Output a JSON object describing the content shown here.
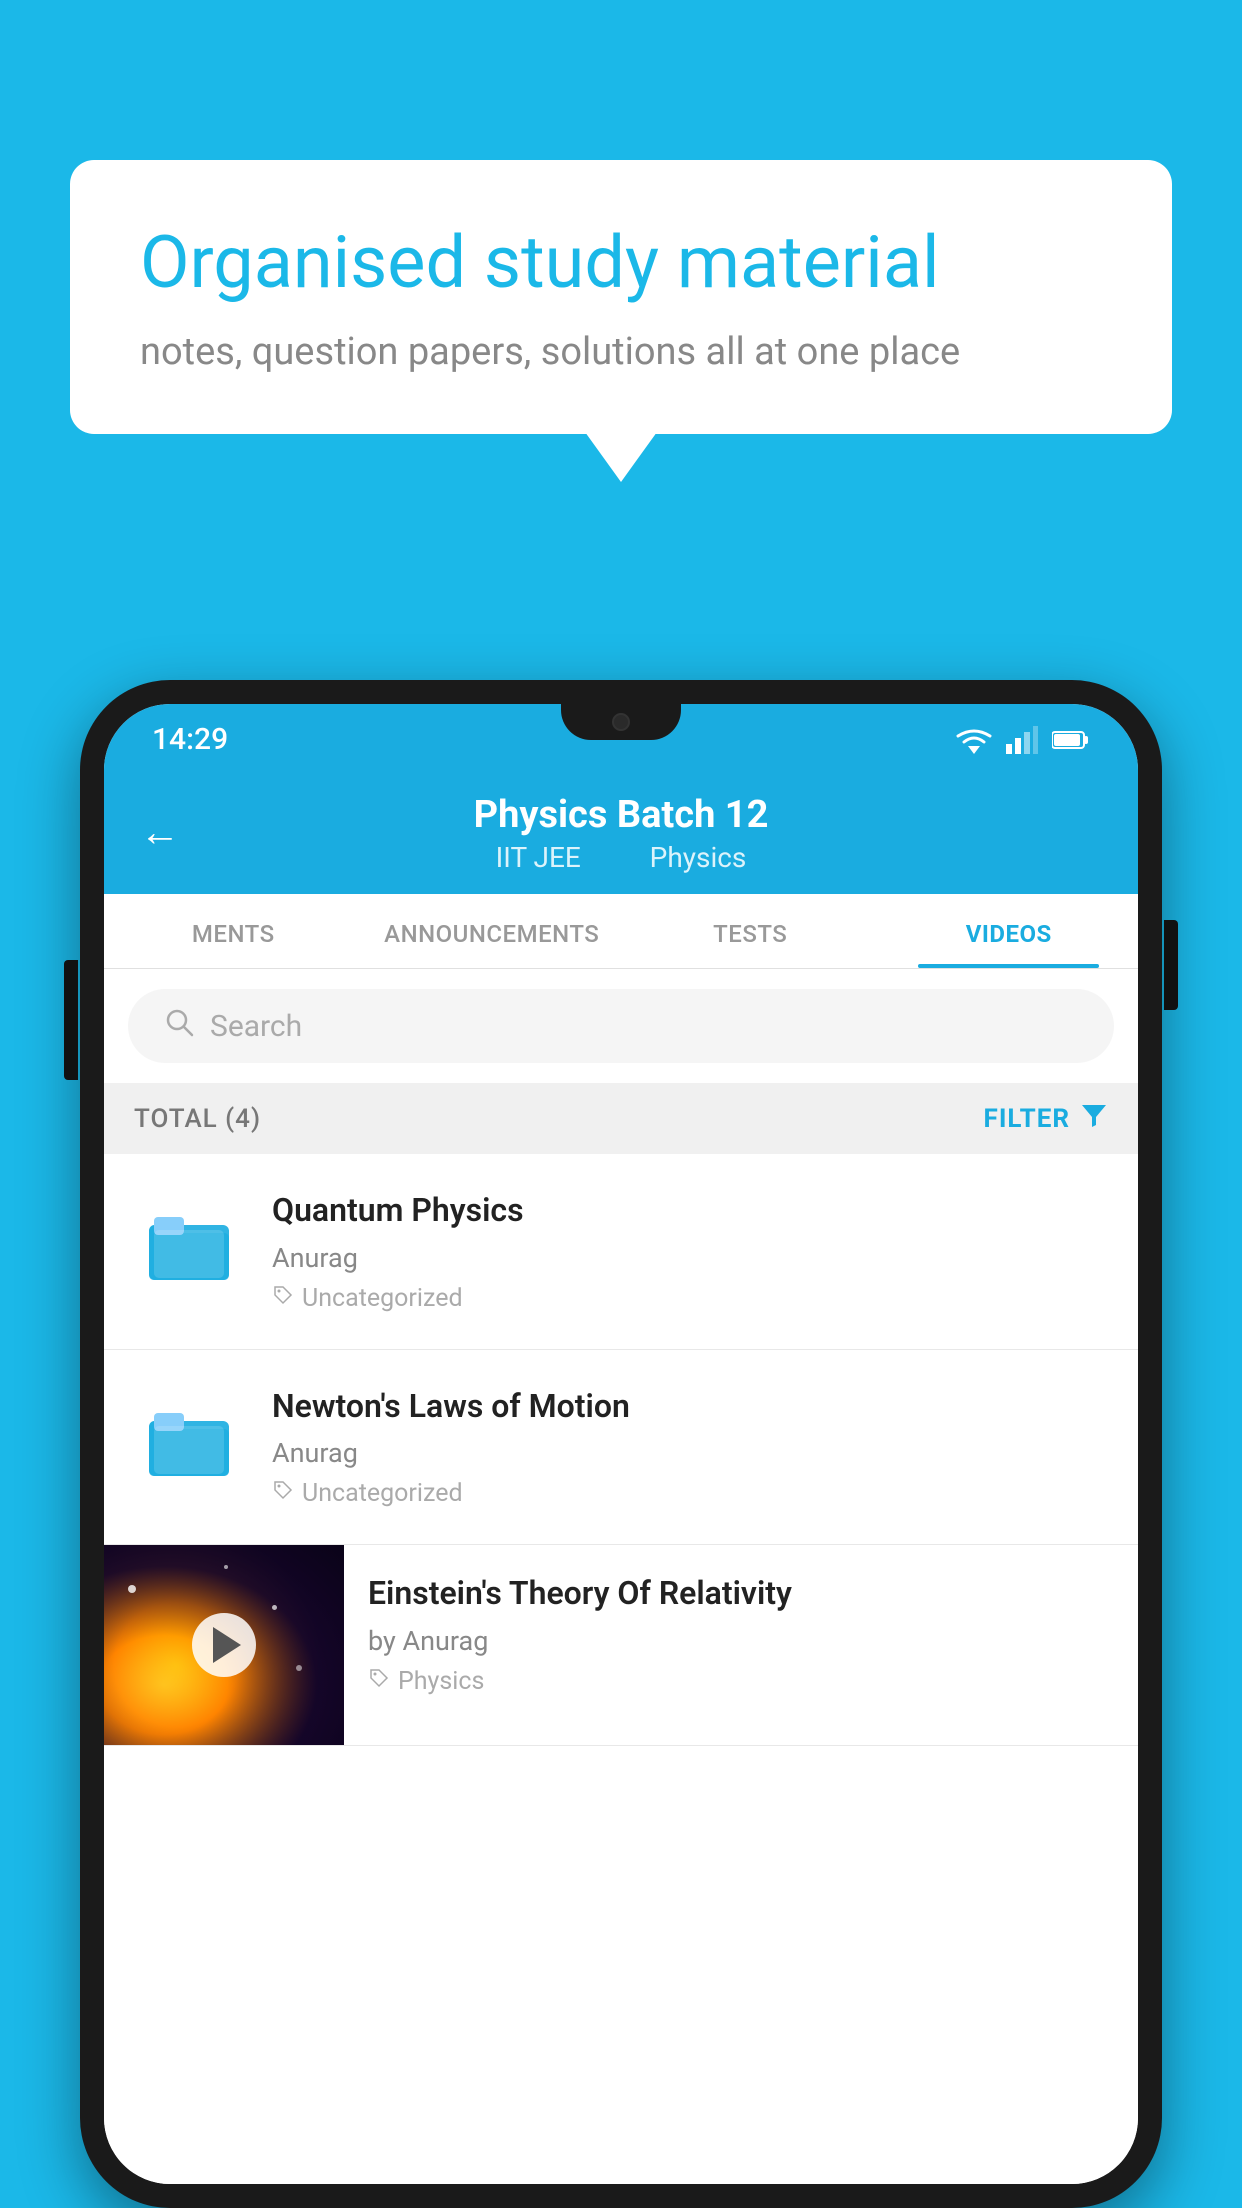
{
  "background_color": "#1BB8E8",
  "bubble": {
    "title": "Organised study material",
    "subtitle": "notes, question papers, solutions all at one place"
  },
  "status_bar": {
    "time": "14:29",
    "wifi_icon": "wifi",
    "signal_icon": "signal",
    "battery_icon": "battery"
  },
  "header": {
    "back_label": "←",
    "title": "Physics Batch 12",
    "subtitle_left": "IIT JEE",
    "subtitle_right": "Physics"
  },
  "tabs": [
    {
      "label": "MENTS",
      "active": false
    },
    {
      "label": "ANNOUNCEMENTS",
      "active": false
    },
    {
      "label": "TESTS",
      "active": false
    },
    {
      "label": "VIDEOS",
      "active": true
    }
  ],
  "search": {
    "placeholder": "Search"
  },
  "filter_bar": {
    "total_label": "TOTAL (4)",
    "filter_label": "FILTER"
  },
  "videos": [
    {
      "type": "folder",
      "title": "Quantum Physics",
      "author": "Anurag",
      "tag": "Uncategorized"
    },
    {
      "type": "folder",
      "title": "Newton's Laws of Motion",
      "author": "Anurag",
      "tag": "Uncategorized"
    },
    {
      "type": "thumbnail",
      "title": "Einstein's Theory Of Relativity",
      "author": "by Anurag",
      "tag": "Physics"
    }
  ]
}
